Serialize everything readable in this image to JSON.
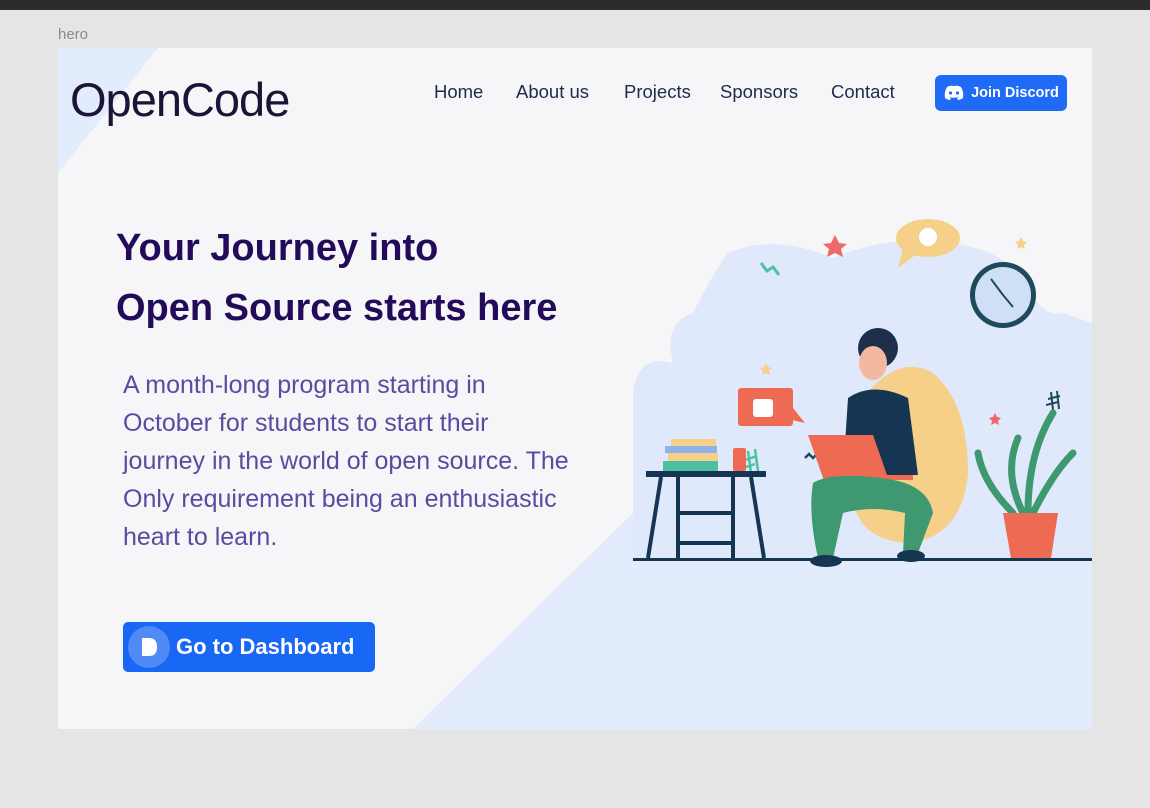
{
  "frame_label": "hero",
  "logo": "OpenCode",
  "nav": {
    "items": [
      {
        "label": "Home"
      },
      {
        "label": "About us"
      },
      {
        "label": "Projects"
      },
      {
        "label": "Sponsors"
      },
      {
        "label": "Contact"
      }
    ],
    "discord_label": "Join Discord"
  },
  "hero": {
    "title_line1": "Your Journey into",
    "title_line2": "Open Source starts here",
    "description": "A month-long program starting in October for students to start their journey in the world of open source. The Only requirement being an enthusiastic heart to learn.",
    "cta_label": "Go to Dashboard"
  },
  "colors": {
    "accent": "#1f6bf5",
    "title": "#230b5a",
    "description": "#5c4aa0",
    "page_bg": "#f6f6f8",
    "soft_blue": "#dfeafd"
  }
}
